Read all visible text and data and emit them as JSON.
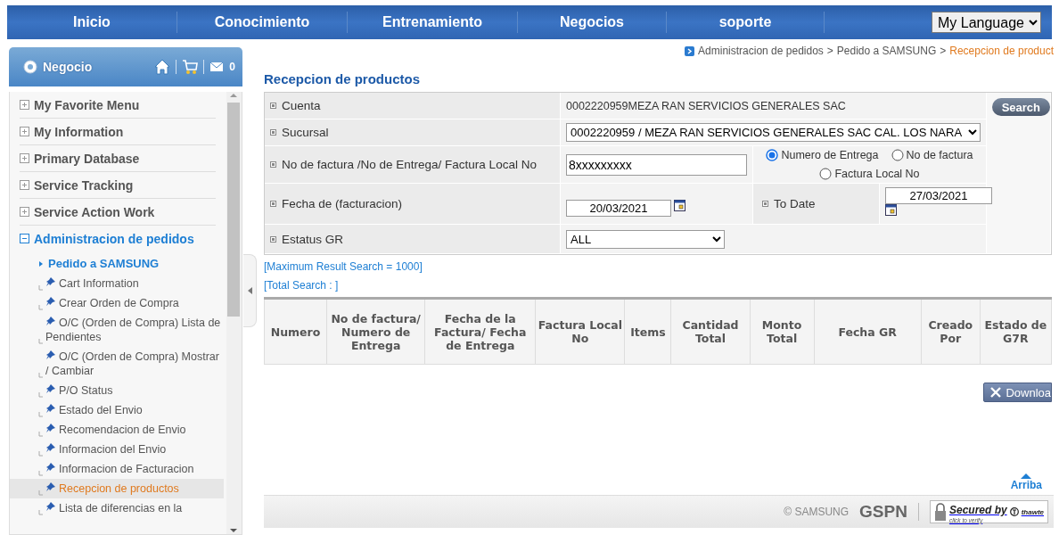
{
  "nav": {
    "items": [
      {
        "label": "Inicio"
      },
      {
        "label": "Conocimiento"
      },
      {
        "label": "Entrenamiento"
      },
      {
        "label": "Negocios"
      },
      {
        "label": "soporte"
      }
    ],
    "language": "My Language"
  },
  "sidebar": {
    "title": "Negocio",
    "message_count": "0",
    "menu": [
      {
        "label": "My Favorite Menu",
        "expanded": false
      },
      {
        "label": "My Information",
        "expanded": false
      },
      {
        "label": "Primary Database",
        "expanded": false
      },
      {
        "label": "Service Tracking",
        "expanded": false
      },
      {
        "label": "Service Action Work",
        "expanded": false
      },
      {
        "label": "Administracion de pedidos",
        "expanded": true,
        "children": [
          {
            "label": "Pedido a SAMSUNG",
            "children": [
              {
                "label": "Cart Information",
                "selected": false
              },
              {
                "label": "Crear Orden de Compra",
                "selected": false
              },
              {
                "label": "O/C (Orden de Compra) Lista de Pendientes",
                "selected": false
              },
              {
                "label": "O/C (Orden de Compra) Mostrar / Cambiar",
                "selected": false
              },
              {
                "label": "P/O Status",
                "selected": false
              },
              {
                "label": "Estado del Envio",
                "selected": false
              },
              {
                "label": "Recomendacion de Envio",
                "selected": false
              },
              {
                "label": "Informacion del Envio",
                "selected": false
              },
              {
                "label": "Informacion de Facturacion",
                "selected": false
              },
              {
                "label": "Recepcion de productos",
                "selected": true
              },
              {
                "label": "Lista de diferencias en la",
                "selected": false
              }
            ]
          }
        ]
      }
    ]
  },
  "breadcrumb": {
    "items": [
      "Administracion de pedidos",
      "Pedido a SAMSUNG",
      "Recepcion de product"
    ],
    "separator": ">"
  },
  "page_title": "Recepcion de productos",
  "form": {
    "cuenta": {
      "label": "Cuenta",
      "value": "0002220959MEZA RAN SERVICIOS GENERALES SAC"
    },
    "sucursal": {
      "label": "Sucursal",
      "value": "0002220959 / MEZA RAN SERVICIOS GENERALES SAC CAL. LOS NARA"
    },
    "factura": {
      "label": "No de factura /No de Entrega/ Factura Local No",
      "value": "8xxxxxxxxx",
      "options": [
        {
          "label": "Numero de Entrega",
          "selected": true
        },
        {
          "label": "No de factura",
          "selected": false
        },
        {
          "label": "Factura Local No",
          "selected": false
        }
      ]
    },
    "fecha": {
      "label": "Fecha de (facturacion)",
      "value": "20/03/2021",
      "to_label": "To Date",
      "to_value": "27/03/2021"
    },
    "estatus": {
      "label": "Estatus GR",
      "value": "ALL"
    },
    "search_button": "Search"
  },
  "notes": [
    "[Maximum Result Search = 1000]",
    "[Total Search : ]"
  ],
  "table": {
    "columns": [
      "Numero",
      "No de factura/ Numero de Entrega",
      "Fecha de la Factura/ Fecha de Entrega",
      "Factura Local No",
      "Items",
      "Cantidad Total",
      "Monto Total",
      "Fecha GR",
      "Creado Por",
      "Estado de G7R"
    ]
  },
  "download_button": "Downloa",
  "top_link": "Arriba",
  "footer": {
    "copyright": "© SAMSUNG",
    "brand": "GSPN",
    "seal_title": "Secured by",
    "seal_sub": "click to verify",
    "seal_brand": "thawte"
  }
}
